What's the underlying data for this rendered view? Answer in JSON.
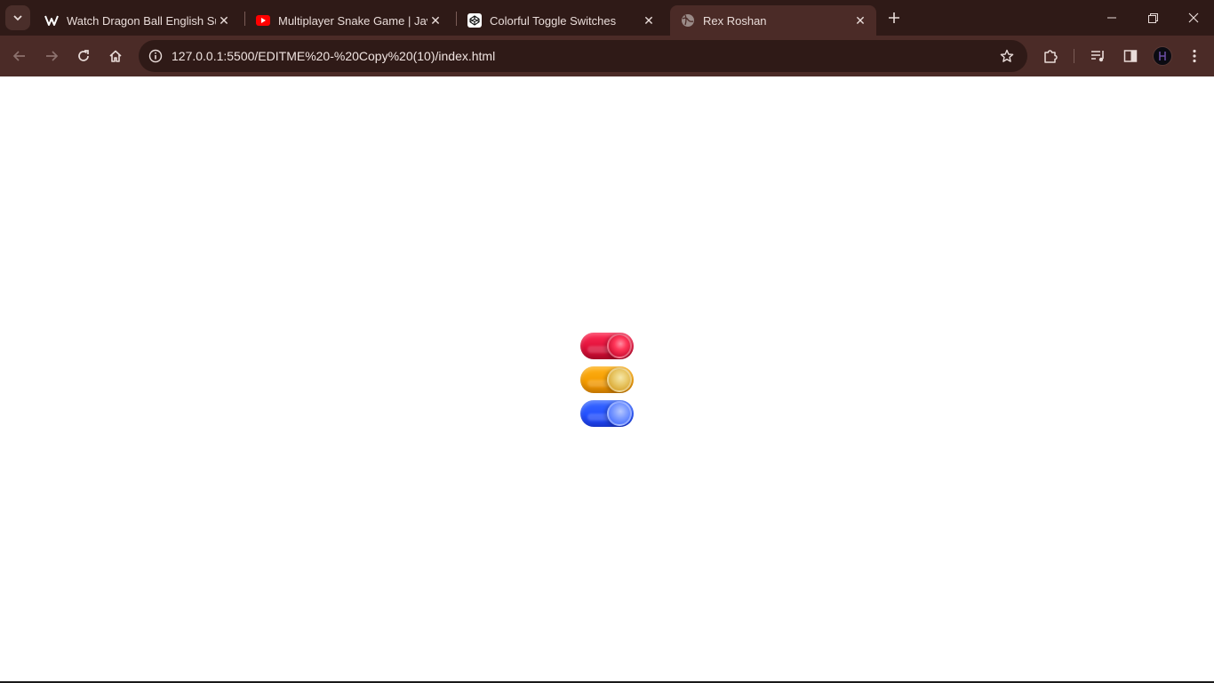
{
  "browser": {
    "tabs": [
      {
        "title": "Watch Dragon Ball English Sub/",
        "icon": "anime-site-icon",
        "active": false
      },
      {
        "title": "Multiplayer Snake Game | JavaS",
        "icon": "youtube-icon",
        "active": false
      },
      {
        "title": "Colorful Toggle Switches",
        "icon": "codepen-icon",
        "active": false
      },
      {
        "title": "Rex Roshan",
        "icon": "globe-icon",
        "active": true
      }
    ],
    "url": "127.0.0.1:5500/EDITME%20-%20Copy%20(10)/index.html",
    "colors": {
      "frame": "#2f1a17",
      "toolbar": "#4b2b27"
    }
  },
  "page": {
    "toggles": [
      {
        "color_name": "red",
        "color": "#e0103a",
        "checked": true
      },
      {
        "color_name": "yellow",
        "color": "#f59c00",
        "checked": true
      },
      {
        "color_name": "blue",
        "color": "#2350ff",
        "checked": true
      }
    ]
  }
}
